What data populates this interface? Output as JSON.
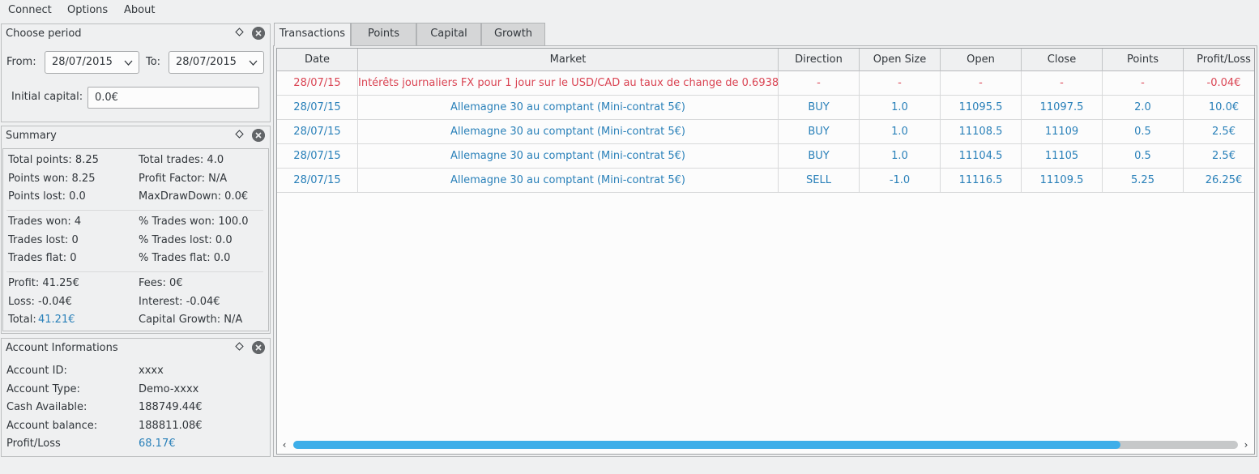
{
  "menu": {
    "connect": "Connect",
    "options": "Options",
    "about": "About"
  },
  "period": {
    "title": "Choose period",
    "from_label": "From:",
    "from_value": "28/07/2015",
    "to_label": "To:",
    "to_value": "28/07/2015",
    "capital_label": "Initial capital:",
    "capital_value": "0.0€"
  },
  "summary": {
    "title": "Summary",
    "total_points": "Total points: 8.25",
    "total_trades": "Total trades: 4.0",
    "points_won": "Points won: 8.25",
    "profit_factor": "Profit Factor: N/A",
    "points_lost": "Points lost: 0.0",
    "max_drawdown": "MaxDrawDown: 0.0€",
    "trades_won": "Trades won: 4",
    "pct_trades_won": "% Trades won: 100.0",
    "trades_lost": "Trades lost: 0",
    "pct_trades_lost": "% Trades lost: 0.0",
    "trades_flat": "Trades flat: 0",
    "pct_trades_flat": "% Trades flat: 0.0",
    "profit": "Profit: 41.25€",
    "fees": "Fees: 0€",
    "loss": "Loss: -0.04€",
    "interest": "Interest: -0.04€",
    "total_label": "Total:",
    "total_value": "41.21€",
    "capital_growth": "Capital Growth: N/A"
  },
  "account": {
    "title": "Account Informations",
    "id_label": "Account ID:",
    "id_value": "xxxx",
    "type_label": "Account Type:",
    "type_value": "Demo-xxxx",
    "cash_label": "Cash Available:",
    "cash_value": "188749.44€",
    "balance_label": "Account balance:",
    "balance_value": "188811.08€",
    "pl_label": "Profit/Loss",
    "pl_value": "68.17€"
  },
  "tabs": [
    "Transactions",
    "Points",
    "Capital",
    "Growth"
  ],
  "table": {
    "columns": [
      "Date",
      "Market",
      "Direction",
      "Open Size",
      "Open",
      "Close",
      "Points",
      "Profit/Loss"
    ],
    "rows": [
      [
        "28/07/15",
        "Intérêts journaliers FX pour 1 jour sur le USD/CAD au taux de change de 0.6938",
        "-",
        "-",
        "-",
        "-",
        "-",
        "-0.04€"
      ],
      [
        "28/07/15",
        "Allemagne 30 au comptant (Mini-contrat 5€)",
        "BUY",
        "1.0",
        "11095.5",
        "11097.5",
        "2.0",
        "10.0€"
      ],
      [
        "28/07/15",
        "Allemagne 30 au comptant (Mini-contrat 5€)",
        "BUY",
        "1.0",
        "11108.5",
        "11109",
        "0.5",
        "2.5€"
      ],
      [
        "28/07/15",
        "Allemagne 30 au comptant (Mini-contrat 5€)",
        "BUY",
        "1.0",
        "11104.5",
        "11105",
        "0.5",
        "2.5€"
      ],
      [
        "28/07/15",
        "Allemagne 30 au comptant (Mini-contrat 5€)",
        "SELL",
        "-1.0",
        "11116.5",
        "11109.5",
        "5.25",
        "26.25€"
      ]
    ],
    "row_colors": [
      "#da4453",
      "#2980b9",
      "#2980b9",
      "#2980b9",
      "#2980b9"
    ]
  },
  "colors": {
    "accent": "#3daee9",
    "loss": "#da4453",
    "profit": "#2980b9"
  },
  "scroll": {
    "thumb_fraction": 0.876
  }
}
